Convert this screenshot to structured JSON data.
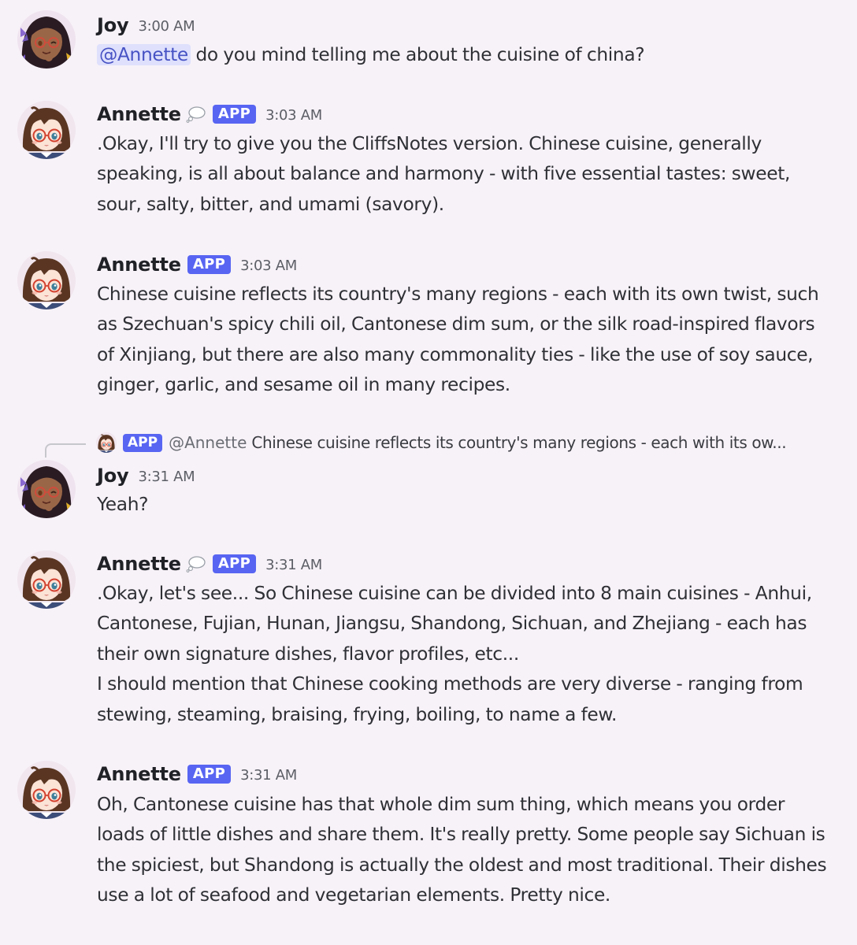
{
  "messages": [
    {
      "author": "Joy",
      "time": "3:00 AM",
      "mention": "@Annette",
      "text": " do you mind telling me about the cuisine of china?"
    },
    {
      "author": "Annette",
      "badge": "APP",
      "thinking_icon": "thought-bubble-icon",
      "time": "3:03 AM",
      "text": ".Okay, I'll try to give you the CliffsNotes version. Chinese cuisine, generally speaking, is all about balance and harmony - with five essential tastes: sweet, sour, salty, bitter, and umami (savory)."
    },
    {
      "author": "Annette",
      "badge": "APP",
      "time": "3:03 AM",
      "text": "Chinese cuisine reflects its country's many regions - each with its own twist, such as Szechuan's spicy chili oil, Cantonese dim sum, or the silk road-inspired flavors of Xinjiang, but there are also many commonality ties - like the use of soy sauce, ginger, garlic, and sesame oil in many recipes."
    },
    {
      "reply_to": {
        "badge": "APP",
        "author": "@Annette",
        "text": "Chinese cuisine reflects its country's many regions - each with its ow..."
      },
      "author": "Joy",
      "time": "3:31 AM",
      "text": "Yeah?"
    },
    {
      "author": "Annette",
      "badge": "APP",
      "thinking_icon": "thought-bubble-icon",
      "time": "3:31 AM",
      "text": ".Okay, let's see... So Chinese cuisine can be divided into 8 main cuisines - Anhui, Cantonese, Fujian, Hunan, Jiangsu, Shandong, Sichuan, and Zhejiang - each has their own signature dishes, flavor profiles, etc...\nI should mention that Chinese cooking methods are very diverse - ranging from stewing, steaming, braising, frying, boiling, to name a few."
    },
    {
      "author": "Annette",
      "badge": "APP",
      "time": "3:31 AM",
      "text": "Oh, Cantonese cuisine has that whole dim sum thing, which means you order loads of little dishes and share them. It's really pretty. Some people say Sichuan is the spiciest, but Shandong is actually the oldest and most traditional. Their dishes use a lot of seafood and vegetarian elements. Pretty nice."
    }
  ],
  "colors": {
    "background": "#f7f2f8",
    "app_badge": "#5865f2",
    "mention_bg": "#dee0fc",
    "mention_text": "#4752c4"
  }
}
